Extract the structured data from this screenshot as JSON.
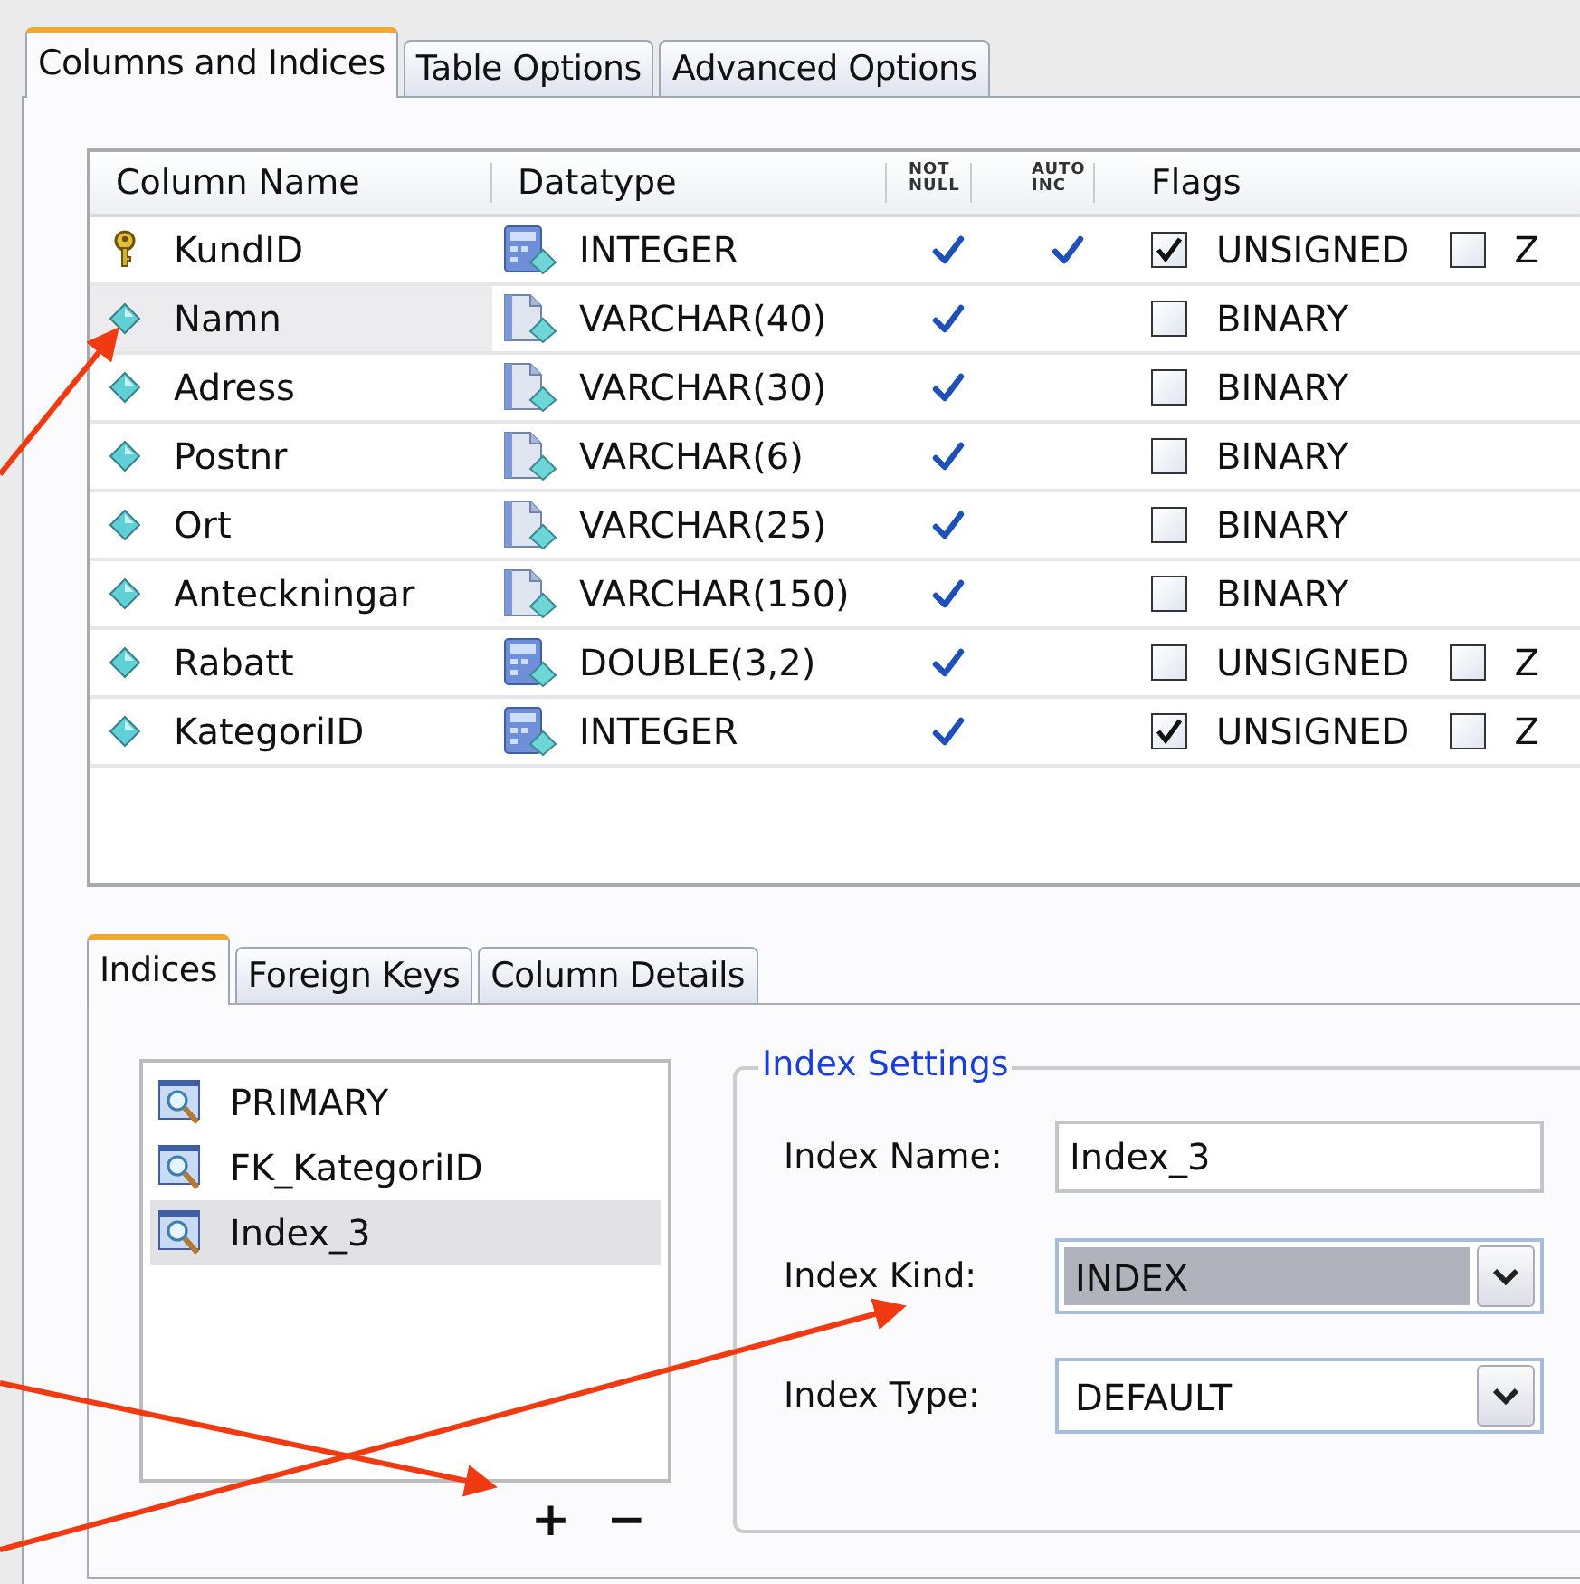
{
  "tabs": [
    {
      "label": "Columns and Indices",
      "selected": true
    },
    {
      "label": "Table Options",
      "selected": false
    },
    {
      "label": "Advanced Options",
      "selected": false
    }
  ],
  "columns_table": {
    "columns": [
      {
        "label": "Column Name",
        "kind": "normal"
      },
      {
        "label": "Datatype",
        "kind": "normal"
      },
      {
        "label": "NOT NULL",
        "kind": "small"
      },
      {
        "label": "AUTO INC",
        "kind": "small"
      },
      {
        "label": "Flags",
        "kind": "normal"
      }
    ],
    "rows": [
      {
        "name": "KundID",
        "kind": "primary_key",
        "datatype": {
          "text": "INTEGER",
          "kind": "numeric"
        },
        "not_null": true,
        "auto_inc": true,
        "selected": false,
        "flags": [
          {
            "label": "UNSIGNED",
            "checked": true
          },
          {
            "label": "Z",
            "checked": false
          }
        ]
      },
      {
        "name": "Namn",
        "kind": "column",
        "datatype": {
          "text": "VARCHAR(40)",
          "kind": "text"
        },
        "not_null": true,
        "auto_inc": false,
        "selected": true,
        "flags": [
          {
            "label": "BINARY",
            "checked": false
          }
        ]
      },
      {
        "name": "Adress",
        "kind": "column",
        "datatype": {
          "text": "VARCHAR(30)",
          "kind": "text"
        },
        "not_null": true,
        "auto_inc": false,
        "selected": false,
        "flags": [
          {
            "label": "BINARY",
            "checked": false
          }
        ]
      },
      {
        "name": "Postnr",
        "kind": "column",
        "datatype": {
          "text": "VARCHAR(6)",
          "kind": "text"
        },
        "not_null": true,
        "auto_inc": false,
        "selected": false,
        "flags": [
          {
            "label": "BINARY",
            "checked": false
          }
        ]
      },
      {
        "name": "Ort",
        "kind": "column",
        "datatype": {
          "text": "VARCHAR(25)",
          "kind": "text"
        },
        "not_null": true,
        "auto_inc": false,
        "selected": false,
        "flags": [
          {
            "label": "BINARY",
            "checked": false
          }
        ]
      },
      {
        "name": "Anteckningar",
        "kind": "column",
        "datatype": {
          "text": "VARCHAR(150)",
          "kind": "text"
        },
        "not_null": true,
        "auto_inc": false,
        "selected": false,
        "flags": [
          {
            "label": "BINARY",
            "checked": false
          }
        ]
      },
      {
        "name": "Rabatt",
        "kind": "column",
        "datatype": {
          "text": "DOUBLE(3,2)",
          "kind": "numeric"
        },
        "not_null": true,
        "auto_inc": false,
        "selected": false,
        "flags": [
          {
            "label": "UNSIGNED",
            "checked": false
          },
          {
            "label": "Z",
            "checked": false
          }
        ]
      },
      {
        "name": "KategoriID",
        "kind": "column",
        "datatype": {
          "text": "INTEGER",
          "kind": "numeric"
        },
        "not_null": true,
        "auto_inc": false,
        "selected": false,
        "flags": [
          {
            "label": "UNSIGNED",
            "checked": true
          },
          {
            "label": "Z",
            "checked": false
          }
        ]
      }
    ]
  },
  "detail_tabs": [
    {
      "label": "Indices",
      "selected": true
    },
    {
      "label": "Foreign Keys",
      "selected": false
    },
    {
      "label": "Column Details",
      "selected": false
    }
  ],
  "indices": [
    {
      "name": "PRIMARY",
      "selected": false
    },
    {
      "name": "FK_KategoriID",
      "selected": false
    },
    {
      "name": "Index_3",
      "selected": true
    }
  ],
  "index_buttons": [
    {
      "label": "+",
      "kind": "add"
    },
    {
      "label": "−",
      "kind": "remove"
    }
  ],
  "index_settings": {
    "title": "Index Settings",
    "fields": [
      {
        "kind": "text",
        "label": "Index Name:",
        "value": "Index_3"
      },
      {
        "kind": "dropdown",
        "label": "Index Kind:",
        "value": "INDEX",
        "focused": true
      },
      {
        "kind": "dropdown",
        "label": "Index Type:",
        "value": "DEFAULT",
        "focused": false
      }
    ]
  }
}
